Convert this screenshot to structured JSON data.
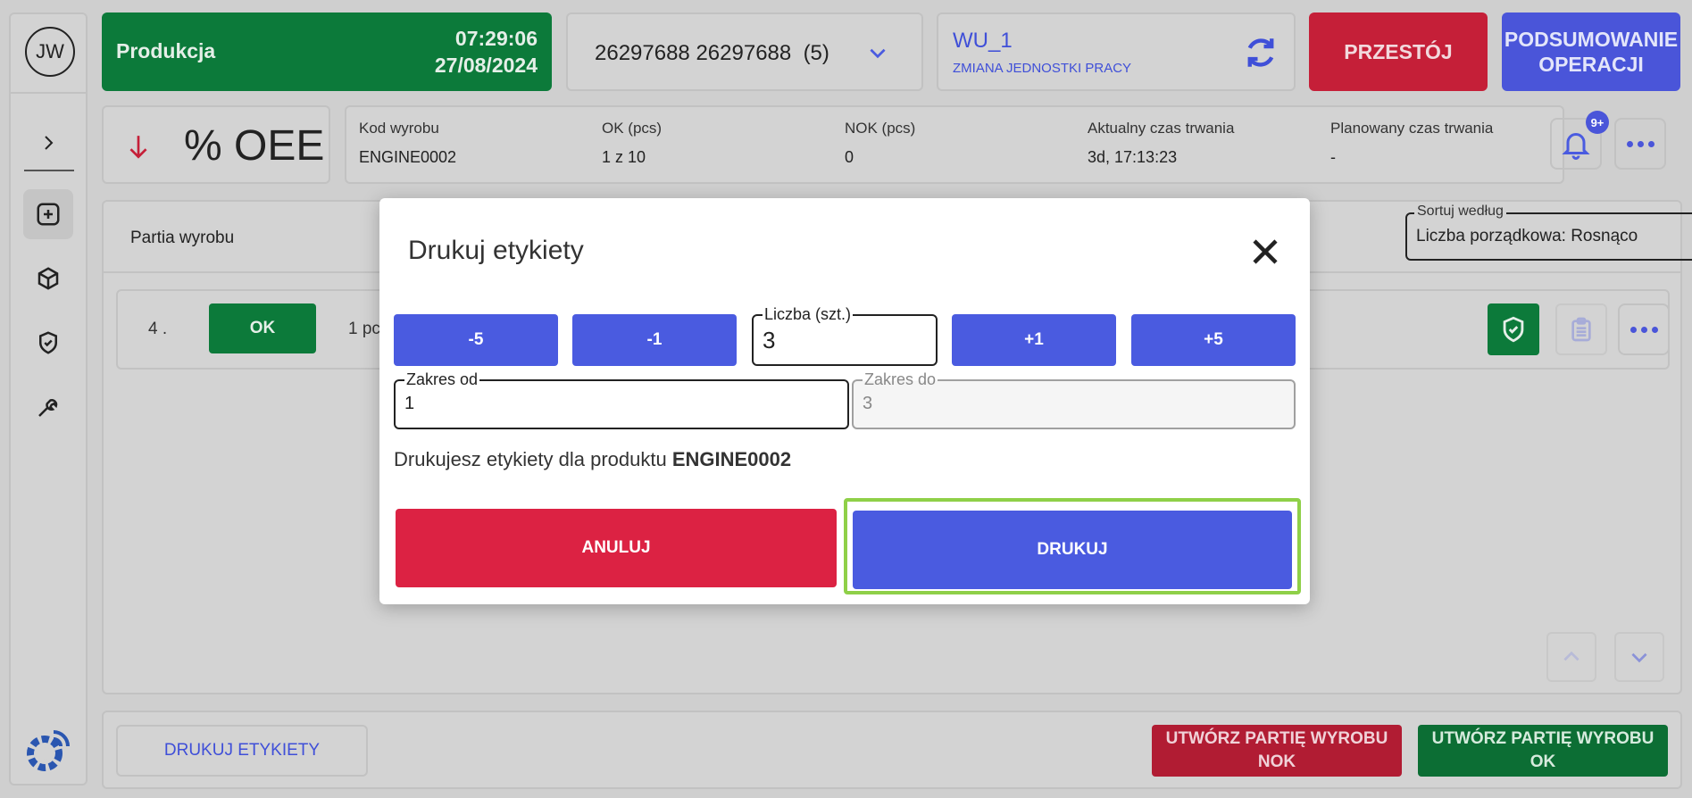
{
  "user": {
    "initials": "JW"
  },
  "status": {
    "label": "Produkcja",
    "time": "07:29:06",
    "date": "27/08/2024",
    "color": "#0c7a3a"
  },
  "order": {
    "selected": "26297688 26297688  (5)"
  },
  "work_unit": {
    "name": "WU_1",
    "change_label": "ZMIANA JEDNOSTKI PRACY"
  },
  "header_buttons": {
    "downtime": "PRZESTÓJ",
    "summary_line1": "PODSUMOWANIE",
    "summary_line2": "OPERACJI"
  },
  "oee": {
    "label": "% OEE"
  },
  "info": {
    "product_code_label": "Kod wyrobu",
    "product_code": "ENGINE0002",
    "ok_label": "OK (pcs)",
    "ok_value": "1 z 10",
    "nok_label": "NOK (pcs)",
    "nok_value": "0",
    "actual_duration_label": "Aktualny czas trwania",
    "actual_duration": "3d, 17:13:23",
    "planned_duration_label": "Planowany czas trwania",
    "planned_duration": "-"
  },
  "notifications": {
    "badge": "9+"
  },
  "batch_list": {
    "header": "Partia wyrobu",
    "sort_label": "Sortuj według",
    "sort_value": "Liczba porządkowa: Rosnąco",
    "rows": [
      {
        "number": "4 .",
        "status": "OK",
        "quantity": "1 pc"
      }
    ]
  },
  "footer": {
    "print_labels": "DRUKUJ ETYKIETY",
    "create_nok_line1": "UTWÓRZ PARTIĘ WYROBU",
    "create_nok_line2": "NOK",
    "create_ok_line1": "UTWÓRZ PARTIĘ WYROBU",
    "create_ok_line2": "OK"
  },
  "dialog": {
    "title": "Drukuj etykiety",
    "steps": [
      "-5",
      "-1",
      "+1",
      "+5"
    ],
    "quantity_label": "Liczba (szt.)",
    "quantity_value": "3",
    "range_from_label": "Zakres od",
    "range_from_value": "1",
    "range_to_label": "Zakres do",
    "range_to_value": "3",
    "message_prefix": "Drukujesz etykiety dla produktu",
    "message_product": "ENGINE0002",
    "cancel": "ANULUJ",
    "print": "DRUKUJ"
  },
  "colors": {
    "accent": "#4a5be0",
    "danger": "#dc2243",
    "success": "#0c7a3a",
    "highlight": "#8fd048"
  }
}
